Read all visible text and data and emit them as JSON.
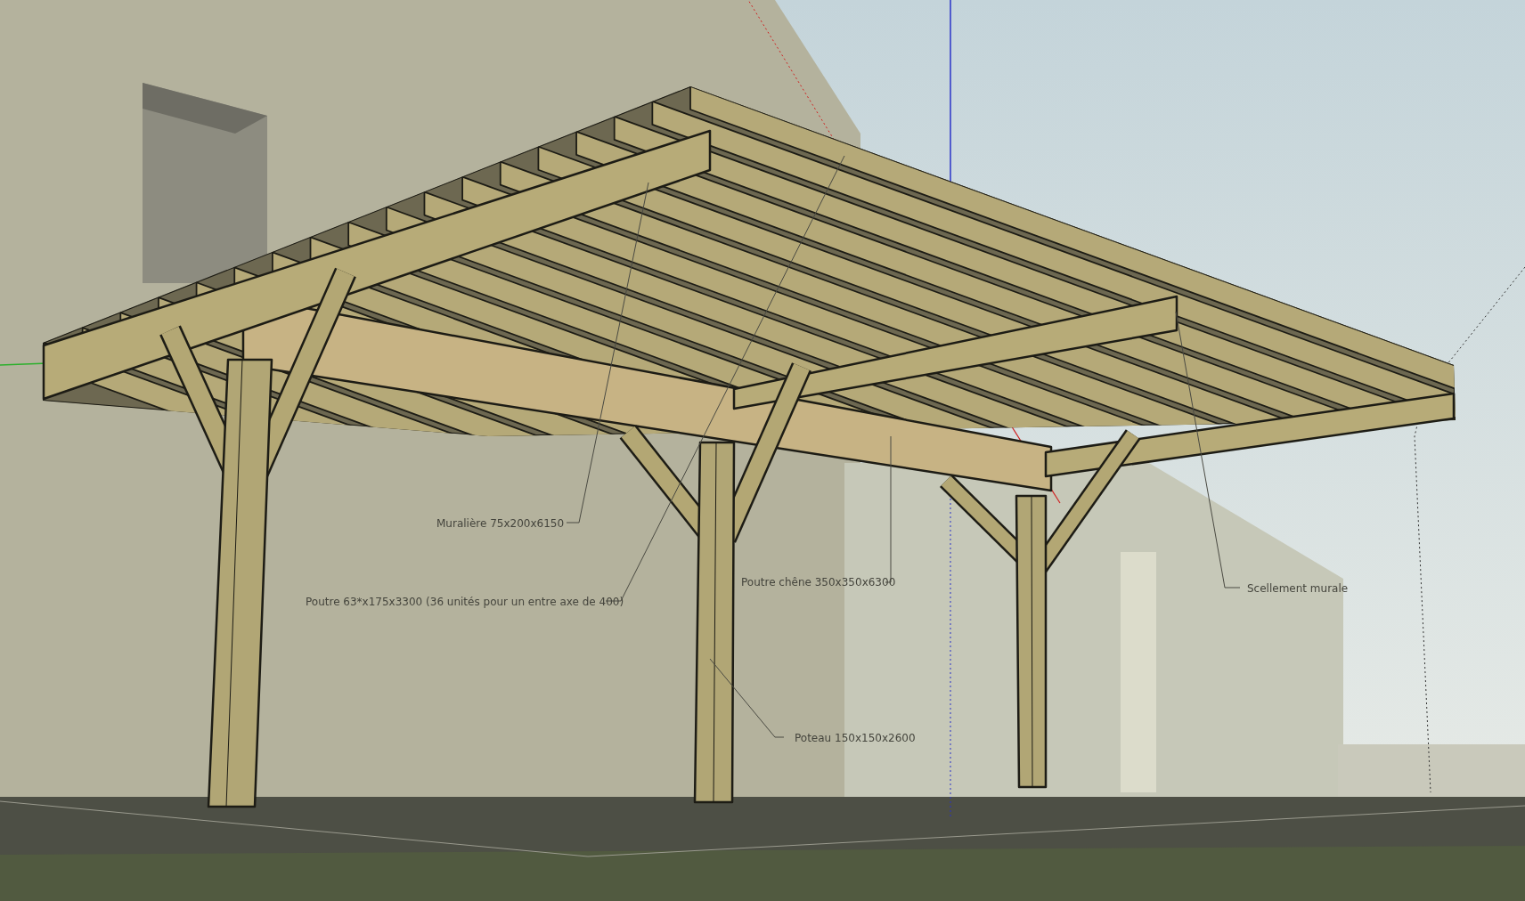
{
  "annotations": [
    {
      "text": "Muralière 75x200x6150"
    },
    {
      "text": "Poutre 63*x175x3300 (36 unités pour un entre axe de 400)"
    },
    {
      "text": "Poutre chêne 350x350x6300"
    },
    {
      "text": "Poteau 150x150x2600"
    },
    {
      "text": "Scellement murale"
    }
  ]
}
